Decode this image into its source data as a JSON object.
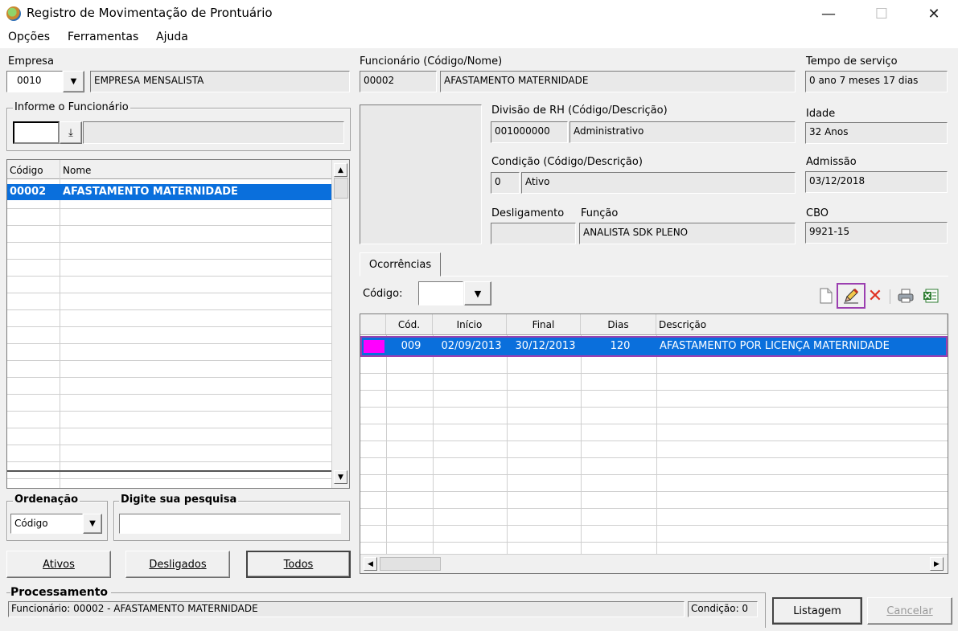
{
  "window": {
    "title": "Registro de Movimentação de Prontuário"
  },
  "menu": [
    "Opções",
    "Ferramentas",
    "Ajuda"
  ],
  "empresa": {
    "label": "Empresa",
    "code": "0010",
    "name": "EMPRESA MENSALISTA"
  },
  "funcionario": {
    "label": "Funcionário (Código/Nome)",
    "code": "00002",
    "name": "AFASTAMENTO MATERNIDADE"
  },
  "tempo_servico": {
    "label": "Tempo de serviço",
    "value": "0 ano 7 meses 17 dias"
  },
  "divisao": {
    "label": "Divisão de RH (Código/Descrição)",
    "code": "001000000",
    "desc": "Administrativo"
  },
  "idade": {
    "label": "Idade",
    "value": "32 Anos"
  },
  "condicao": {
    "label": "Condição (Código/Descrição)",
    "code": "0",
    "desc": "Ativo"
  },
  "admissao": {
    "label": "Admissão",
    "value": "03/12/2018"
  },
  "desligamento": {
    "label": "Desligamento",
    "value": ""
  },
  "funcao": {
    "label": "Função",
    "value": "ANALISTA SDK PLENO"
  },
  "cbo": {
    "label": "CBO",
    "value": "9921-15"
  },
  "informe": {
    "label": "Informe o Funcionário",
    "value": ""
  },
  "employee_list": {
    "headers": [
      "Código",
      "Nome"
    ],
    "rows": [
      {
        "code": "00002",
        "name": "AFASTAMENTO MATERNIDADE"
      }
    ]
  },
  "ordenacao": {
    "label": "Ordenação",
    "value": "Código"
  },
  "pesquisa": {
    "label": "Digite sua pesquisa",
    "value": ""
  },
  "filter_buttons": {
    "ativos": "Ativos",
    "desligados": "Desligados",
    "todos": "Todos"
  },
  "tab": {
    "label": "Ocorrências"
  },
  "codigo_filter": {
    "label": "Código:",
    "value": ""
  },
  "occurrences": {
    "headers": [
      "Cód.",
      "Início",
      "Final",
      "Dias",
      "Descrição"
    ],
    "rows": [
      {
        "cod": "009",
        "inicio": "02/09/2013",
        "final": "30/12/2013",
        "dias": "120",
        "descricao": "AFASTAMENTO POR LICENÇA MATERNIDADE"
      }
    ]
  },
  "processamento": {
    "label": "Processamento",
    "status": "Funcionário: 00002 - AFASTAMENTO MATERNIDADE",
    "condicao": "Condição: 0"
  },
  "bottom_buttons": {
    "listagem": "Listagem",
    "cancelar": "Cancelar"
  },
  "colors": {
    "selection": "#0a6fdc",
    "row_marker": "#ff00ff",
    "highlight_border": "#9b3fb0",
    "delete_icon": "#e03020"
  }
}
